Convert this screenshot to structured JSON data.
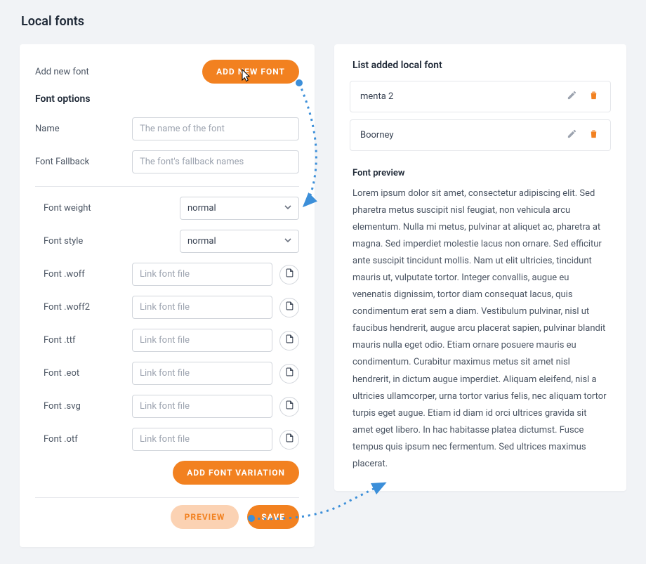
{
  "page": {
    "title": "Local fonts"
  },
  "addFont": {
    "label": "Add new font",
    "button": "ADD NEW FONT"
  },
  "fontOptions": {
    "title": "Font options",
    "name": {
      "label": "Name",
      "placeholder": "The name of the font"
    },
    "fallback": {
      "label": "Font Fallback",
      "placeholder": "The font's fallback names"
    },
    "weight": {
      "label": "Font weight",
      "value": "normal"
    },
    "style": {
      "label": "Font style",
      "value": "normal"
    },
    "files": [
      {
        "label": "Font .woff",
        "placeholder": "Link font file"
      },
      {
        "label": "Font .woff2",
        "placeholder": "Link font file"
      },
      {
        "label": "Font .ttf",
        "placeholder": "Link font file"
      },
      {
        "label": "Font .eot",
        "placeholder": "Link font file"
      },
      {
        "label": "Font .svg",
        "placeholder": "Link font file"
      },
      {
        "label": "Font .otf",
        "placeholder": "Link font file"
      }
    ],
    "addVariation": "ADD FONT VARIATION",
    "preview": "PREVIEW",
    "save": "SAVE"
  },
  "list": {
    "title": "List added local font",
    "items": [
      {
        "name": "menta 2"
      },
      {
        "name": "Boorney"
      }
    ]
  },
  "preview": {
    "title": "Font preview",
    "text": "Lorem ipsum dolor sit amet, consectetur adipiscing elit. Sed pharetra metus suscipit nisl feugiat, non vehicula arcu elementum. Nulla mi metus, pulvinar at aliquet ac, pharetra at magna. Sed imperdiet molestie lacus non ornare. Sed efficitur ante suscipit tincidunt mollis. Nam ut elit ultricies, tincidunt mauris ut, vulputate tortor. Integer convallis, augue eu venenatis dignissim, tortor diam consequat lacus, quis condimentum erat sem a diam. Vestibulum pulvinar, nisl ut faucibus hendrerit, augue arcu placerat sapien, pulvinar blandit mauris nulla eget odio. Etiam ornare posuere mauris eu condimentum. Curabitur maximus metus sit amet nisl hendrerit, in dictum augue imperdiet. Aliquam eleifend, nisl a ultricies ullamcorper, urna tortor varius felis, nec aliquam tortor turpis eget augue. Etiam id diam id orci ultrices gravida sit amet eget libero. In hac habitasse platea dictumst. Fusce tempus quis ipsum nec fermentum. Sed ultrices maximus placerat."
  },
  "icons": {
    "edit": "pencil-icon",
    "delete": "trash-icon",
    "file": "file-icon",
    "chevron": "chevron-down-icon"
  },
  "colors": {
    "accent": "#f28120"
  }
}
